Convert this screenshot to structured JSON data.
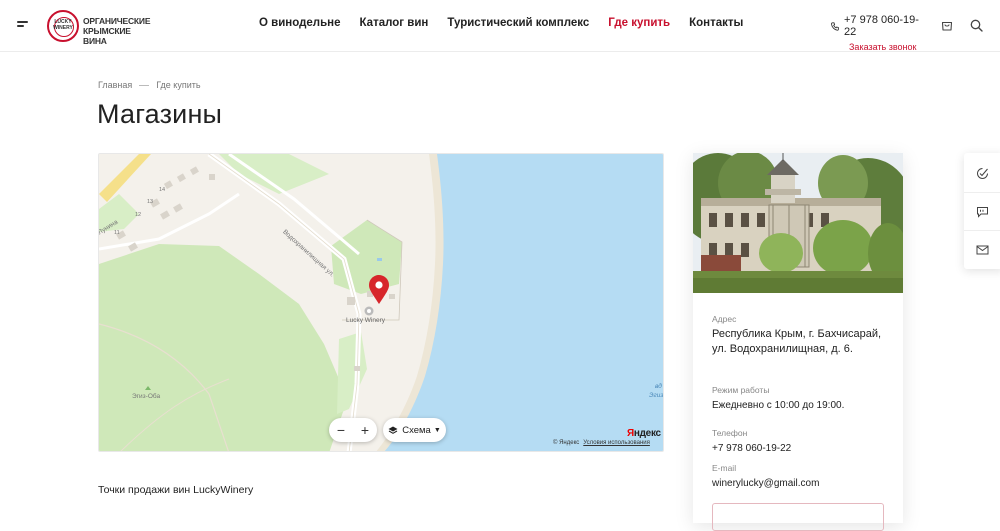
{
  "header": {
    "logo_mark": "LUCKY WINERY",
    "logo_text_line1": "Органические",
    "logo_text_line2": "крымские вина",
    "nav": [
      {
        "label": "О винодельне",
        "active": false
      },
      {
        "label": "Каталог вин",
        "active": false
      },
      {
        "label": "Туристический комплекс",
        "active": false
      },
      {
        "label": "Где купить",
        "active": true
      },
      {
        "label": "Контакты",
        "active": false
      }
    ],
    "phone": "+7 978 060-19-22",
    "callback_label": "Заказать звонок",
    "icons": [
      "menu-icon",
      "phone-icon",
      "cart-icon",
      "search-icon"
    ]
  },
  "breadcrumb": {
    "home": "Главная",
    "current": "Где купить"
  },
  "page": {
    "title": "Магазины",
    "intro": "Точки продажи вин LuckyWinery"
  },
  "map": {
    "street_label": "Водохранилищная ул.",
    "street_label_2": "Лунина",
    "marker_label": "Lucky Winery",
    "place_label": "Эгиз-Оба",
    "house_numbers": [
      "12",
      "13",
      "14",
      "11"
    ],
    "water_label_1": "вд",
    "water_label_2": "Эгиз",
    "zoom_out": "−",
    "zoom_in": "+",
    "layer_label": "Схема",
    "yandex_logo_1": "Я",
    "yandex_logo_2": "ндекс",
    "copyright": "© Яндекс",
    "terms_link": "Условия использования",
    "colors": {
      "water": "#b5dcf3",
      "park": "#cfe8b9",
      "land": "#f4f1eb",
      "marker": "#d7262b"
    }
  },
  "shop": {
    "address_label": "Адрес",
    "address_value": "Республика Крым, г. Бахчисарай, ул. Водохранилищная, д. 6.",
    "hours_label": "Режим работы",
    "hours_value": "Ежедневно с 10:00 до 19:00.",
    "phone_label": "Телефон",
    "phone_value": "+7 978 060-19-22",
    "email_label": "E-mail",
    "email_value": "winerylucky@gmail.com"
  },
  "side_panel": {
    "icons": [
      "feedback-icon",
      "chat-icon",
      "mail-icon"
    ]
  },
  "theme": {
    "accent": "#c8102e"
  }
}
